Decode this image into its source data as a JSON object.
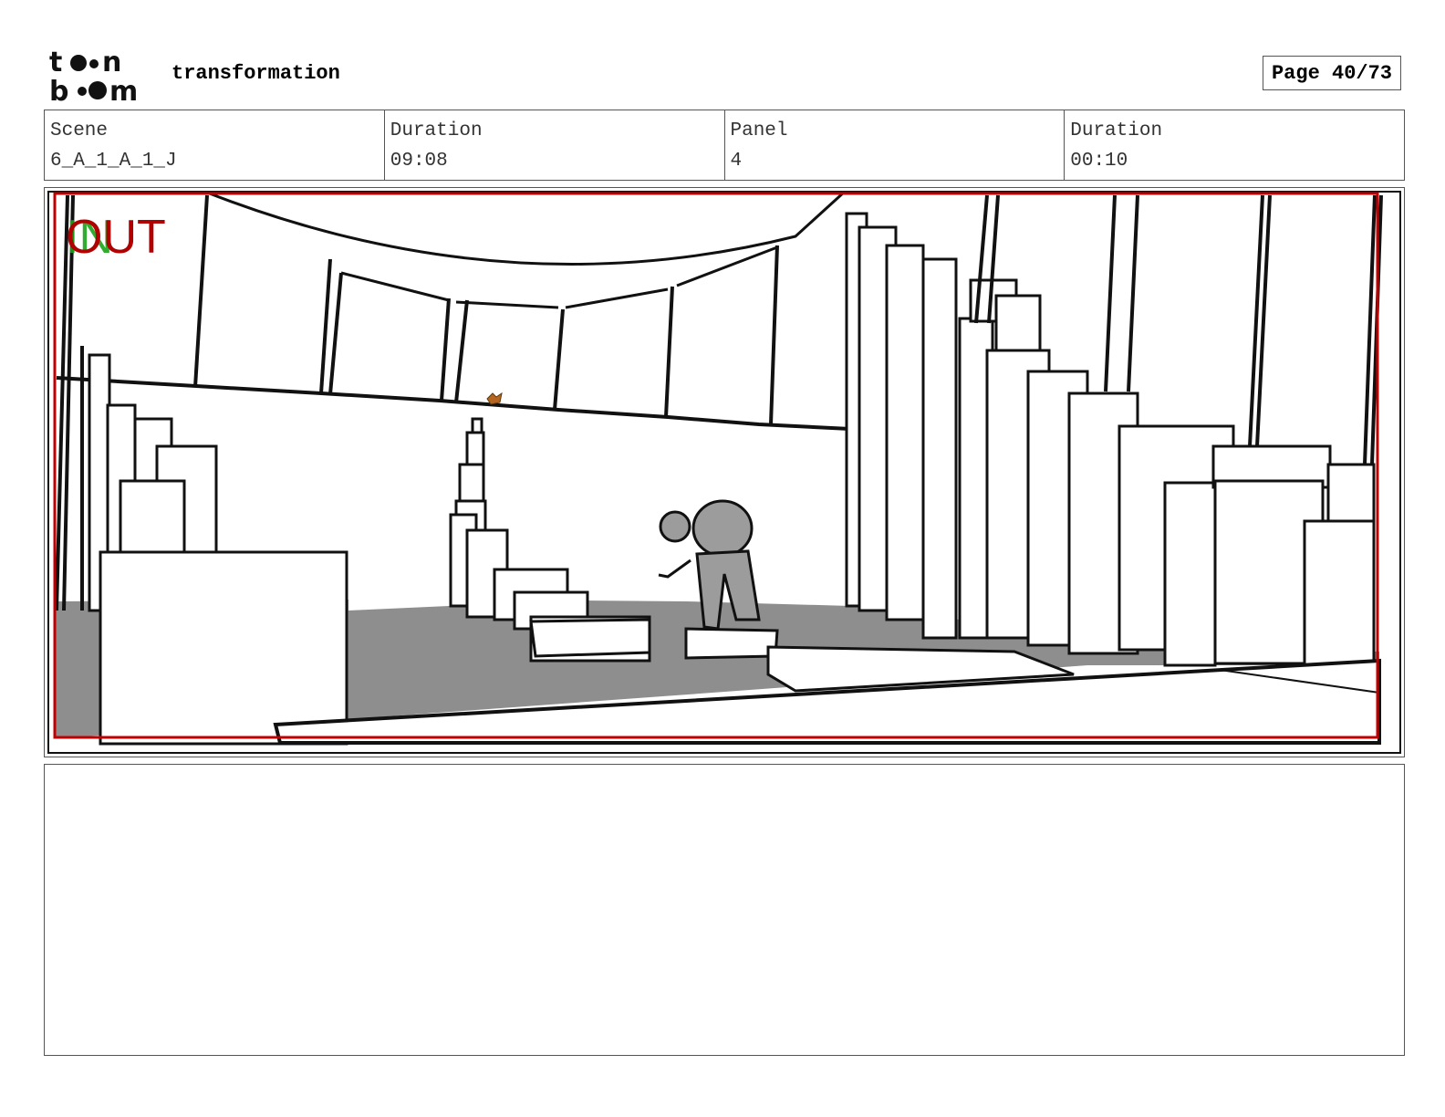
{
  "header": {
    "logo_text": "toon boom",
    "project_title": "transformation",
    "page_label": "Page 40/73"
  },
  "info": {
    "scene_label": "Scene",
    "scene_value": "6_A_1_A_1_J",
    "scene_duration_label": "Duration",
    "scene_duration_value": "09:08",
    "panel_label": "Panel",
    "panel_value": "4",
    "panel_duration_label": "Duration",
    "panel_duration_value": "00:10"
  },
  "panel": {
    "overlay_in": "IN",
    "overlay_out": "OUT",
    "frame_color": "#c00000",
    "in_color": "#1aa51a"
  },
  "notes": {
    "text": ""
  }
}
